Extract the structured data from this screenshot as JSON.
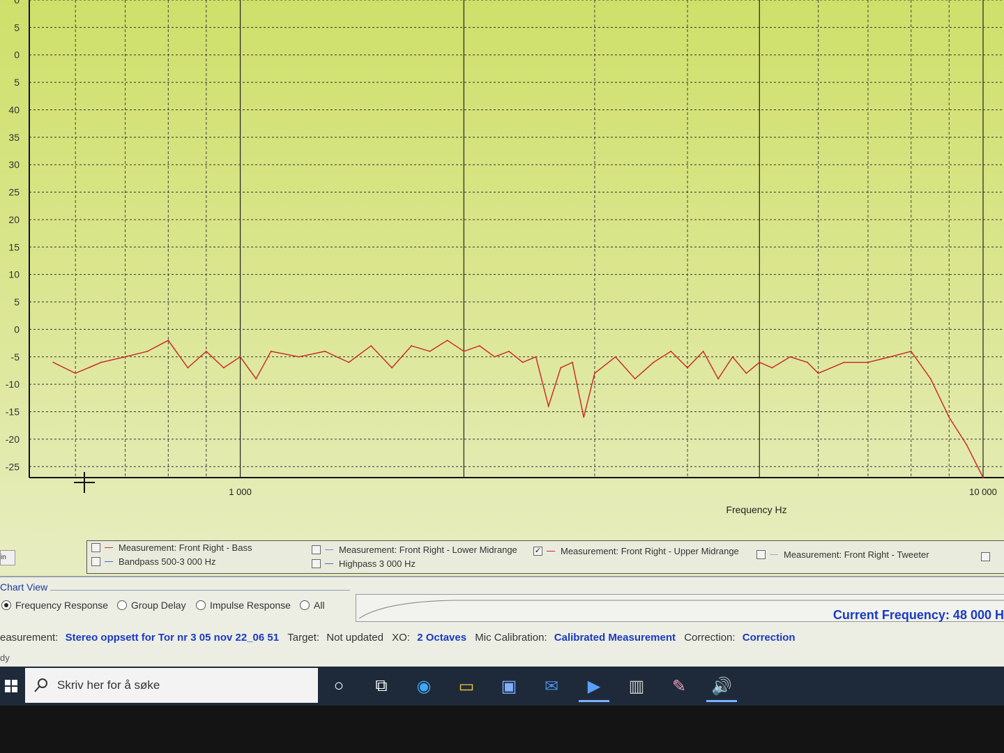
{
  "chart_data": {
    "type": "line",
    "xlabel": "Frequency Hz",
    "x_scale": "log",
    "x_tick_labels": [
      "1 000",
      "10 000"
    ],
    "y_tick_labels": [
      "5",
      "0",
      "5",
      "0",
      "5",
      "0",
      "5",
      "40",
      "35",
      "30",
      "25",
      "20",
      "15",
      "10",
      "5",
      "0",
      "-5",
      "-10",
      "-15",
      "-20",
      "-25"
    ],
    "ylim": [
      -27,
      60
    ],
    "grid": true,
    "series": [
      {
        "name": "Measurement: Front Right - Upper Midrange",
        "color": "#cc2222",
        "x": [
          560,
          600,
          650,
          700,
          750,
          800,
          850,
          900,
          950,
          1000,
          1050,
          1100,
          1200,
          1300,
          1400,
          1500,
          1600,
          1700,
          1800,
          1900,
          2000,
          2100,
          2200,
          2300,
          2400,
          2500,
          2600,
          2700,
          2800,
          2900,
          3000,
          3200,
          3400,
          3600,
          3800,
          4000,
          4200,
          4400,
          4600,
          4800,
          5000,
          5200,
          5500,
          5800,
          6000,
          6500,
          7000,
          7500,
          8000,
          8500,
          9000,
          9500,
          10000
        ],
        "y": [
          -6,
          -8,
          -6,
          -5,
          -4,
          -2,
          -7,
          -4,
          -7,
          -5,
          -9,
          -4,
          -5,
          -4,
          -6,
          -3,
          -7,
          -3,
          -4,
          -2,
          -4,
          -3,
          -5,
          -4,
          -6,
          -5,
          -14,
          -7,
          -6,
          -16,
          -8,
          -5,
          -9,
          -6,
          -4,
          -7,
          -4,
          -9,
          -5,
          -8,
          -6,
          -7,
          -5,
          -6,
          -8,
          -6,
          -6,
          -5,
          -4,
          -9,
          -16,
          -21,
          -27
        ]
      }
    ]
  },
  "legend": {
    "items": [
      {
        "label": "Measurement: Front Right - Bass",
        "checked": false,
        "color": "#cc3333"
      },
      {
        "label": "Bandpass   500-3 000 Hz",
        "checked": false,
        "color": "#4466cc"
      },
      {
        "label": "Measurement: Front Right - Lower Midrange",
        "checked": false,
        "color": "#6688dd"
      },
      {
        "label": "Highpass  3 000 Hz",
        "checked": false,
        "color": "#4466cc"
      },
      {
        "label": "Measurement: Front Right - Upper Midrange",
        "checked": true,
        "color": "#cc2222"
      },
      {
        "label": "Measurement: Front Right - Tweeter",
        "checked": false,
        "color": "#99aadd"
      }
    ],
    "checkmark": "✓"
  },
  "small_button": "in",
  "chart_view": {
    "title": "Chart View",
    "options": [
      "Frequency Response",
      "Group Delay",
      "Impulse Response",
      "All"
    ],
    "selected": "Frequency Response"
  },
  "current_frequency": "Current Frequency:  48 000 H",
  "status": {
    "measurement_label": "easurement:",
    "measurement_value": "Stereo oppsett for Tor nr 3 05 nov 22_06 51",
    "target_label": "Target:",
    "target_value": "Not updated",
    "xo_label": "XO:",
    "xo_value": "2 Octaves",
    "mic_label": "Mic Calibration:",
    "mic_value": "Calibrated Measurement",
    "correction_label": "Correction:",
    "correction_value": "Correction"
  },
  "ready_text": "dy",
  "taskbar": {
    "search_placeholder": "Skriv her for å søke",
    "icons": [
      "cortana-icon",
      "task-view-icon",
      "edge-icon",
      "file-explorer-icon",
      "store-icon",
      "mail-icon",
      "media-player-icon",
      "equalizer-app-icon",
      "paint-icon",
      "audio-app-icon"
    ]
  }
}
